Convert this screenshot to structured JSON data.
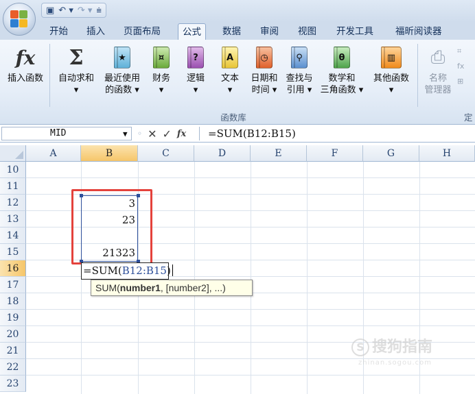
{
  "qat": {
    "save_icon": "save-icon",
    "undo": "↶ ▾",
    "redo": "↷ ▾",
    "customize": "⩧"
  },
  "tabs": [
    "开始",
    "插入",
    "页面布局",
    "公式",
    "数据",
    "审阅",
    "视图",
    "开发工具",
    "福昕阅读器"
  ],
  "active_tab": "公式",
  "ribbon": {
    "insert_fn": "插入函数",
    "autosum": [
      "自动求和",
      "▾"
    ],
    "recent": [
      "最近使用",
      "的函数 ▾"
    ],
    "finance": [
      "财务",
      "▾"
    ],
    "logic": [
      "逻辑",
      "▾"
    ],
    "text": [
      "文本",
      "▾"
    ],
    "datetime": [
      "日期和",
      "时间 ▾"
    ],
    "lookup": [
      "查找与",
      "引用 ▾"
    ],
    "math": [
      "数学和",
      "三角函数 ▾"
    ],
    "other": [
      "其他函数",
      "▾"
    ],
    "name_mgr": [
      "名称",
      "管理器"
    ],
    "group_label": "函数库",
    "group_label2": "定"
  },
  "formula_bar": {
    "name_box": "MID",
    "fx": "fx",
    "formula": "=SUM(B12:B15)"
  },
  "columns": [
    "A",
    "B",
    "C",
    "D",
    "E",
    "F",
    "G",
    "H"
  ],
  "rows": [
    "10",
    "11",
    "12",
    "13",
    "14",
    "15",
    "16",
    "17",
    "18",
    "19",
    "20",
    "21",
    "22",
    "23"
  ],
  "cells": {
    "B12": "3",
    "B13": "23",
    "B15": "21323"
  },
  "edit": {
    "prefix": "=SUM(",
    "ref": "B12:B15",
    "suffix": ")"
  },
  "tooltip": {
    "fn": "SUM(",
    "arg1": "number1",
    "rest": ", [number2], ...)"
  },
  "watermark": {
    "text": "搜狗指南",
    "sub": "zhinan.sogou.com"
  }
}
